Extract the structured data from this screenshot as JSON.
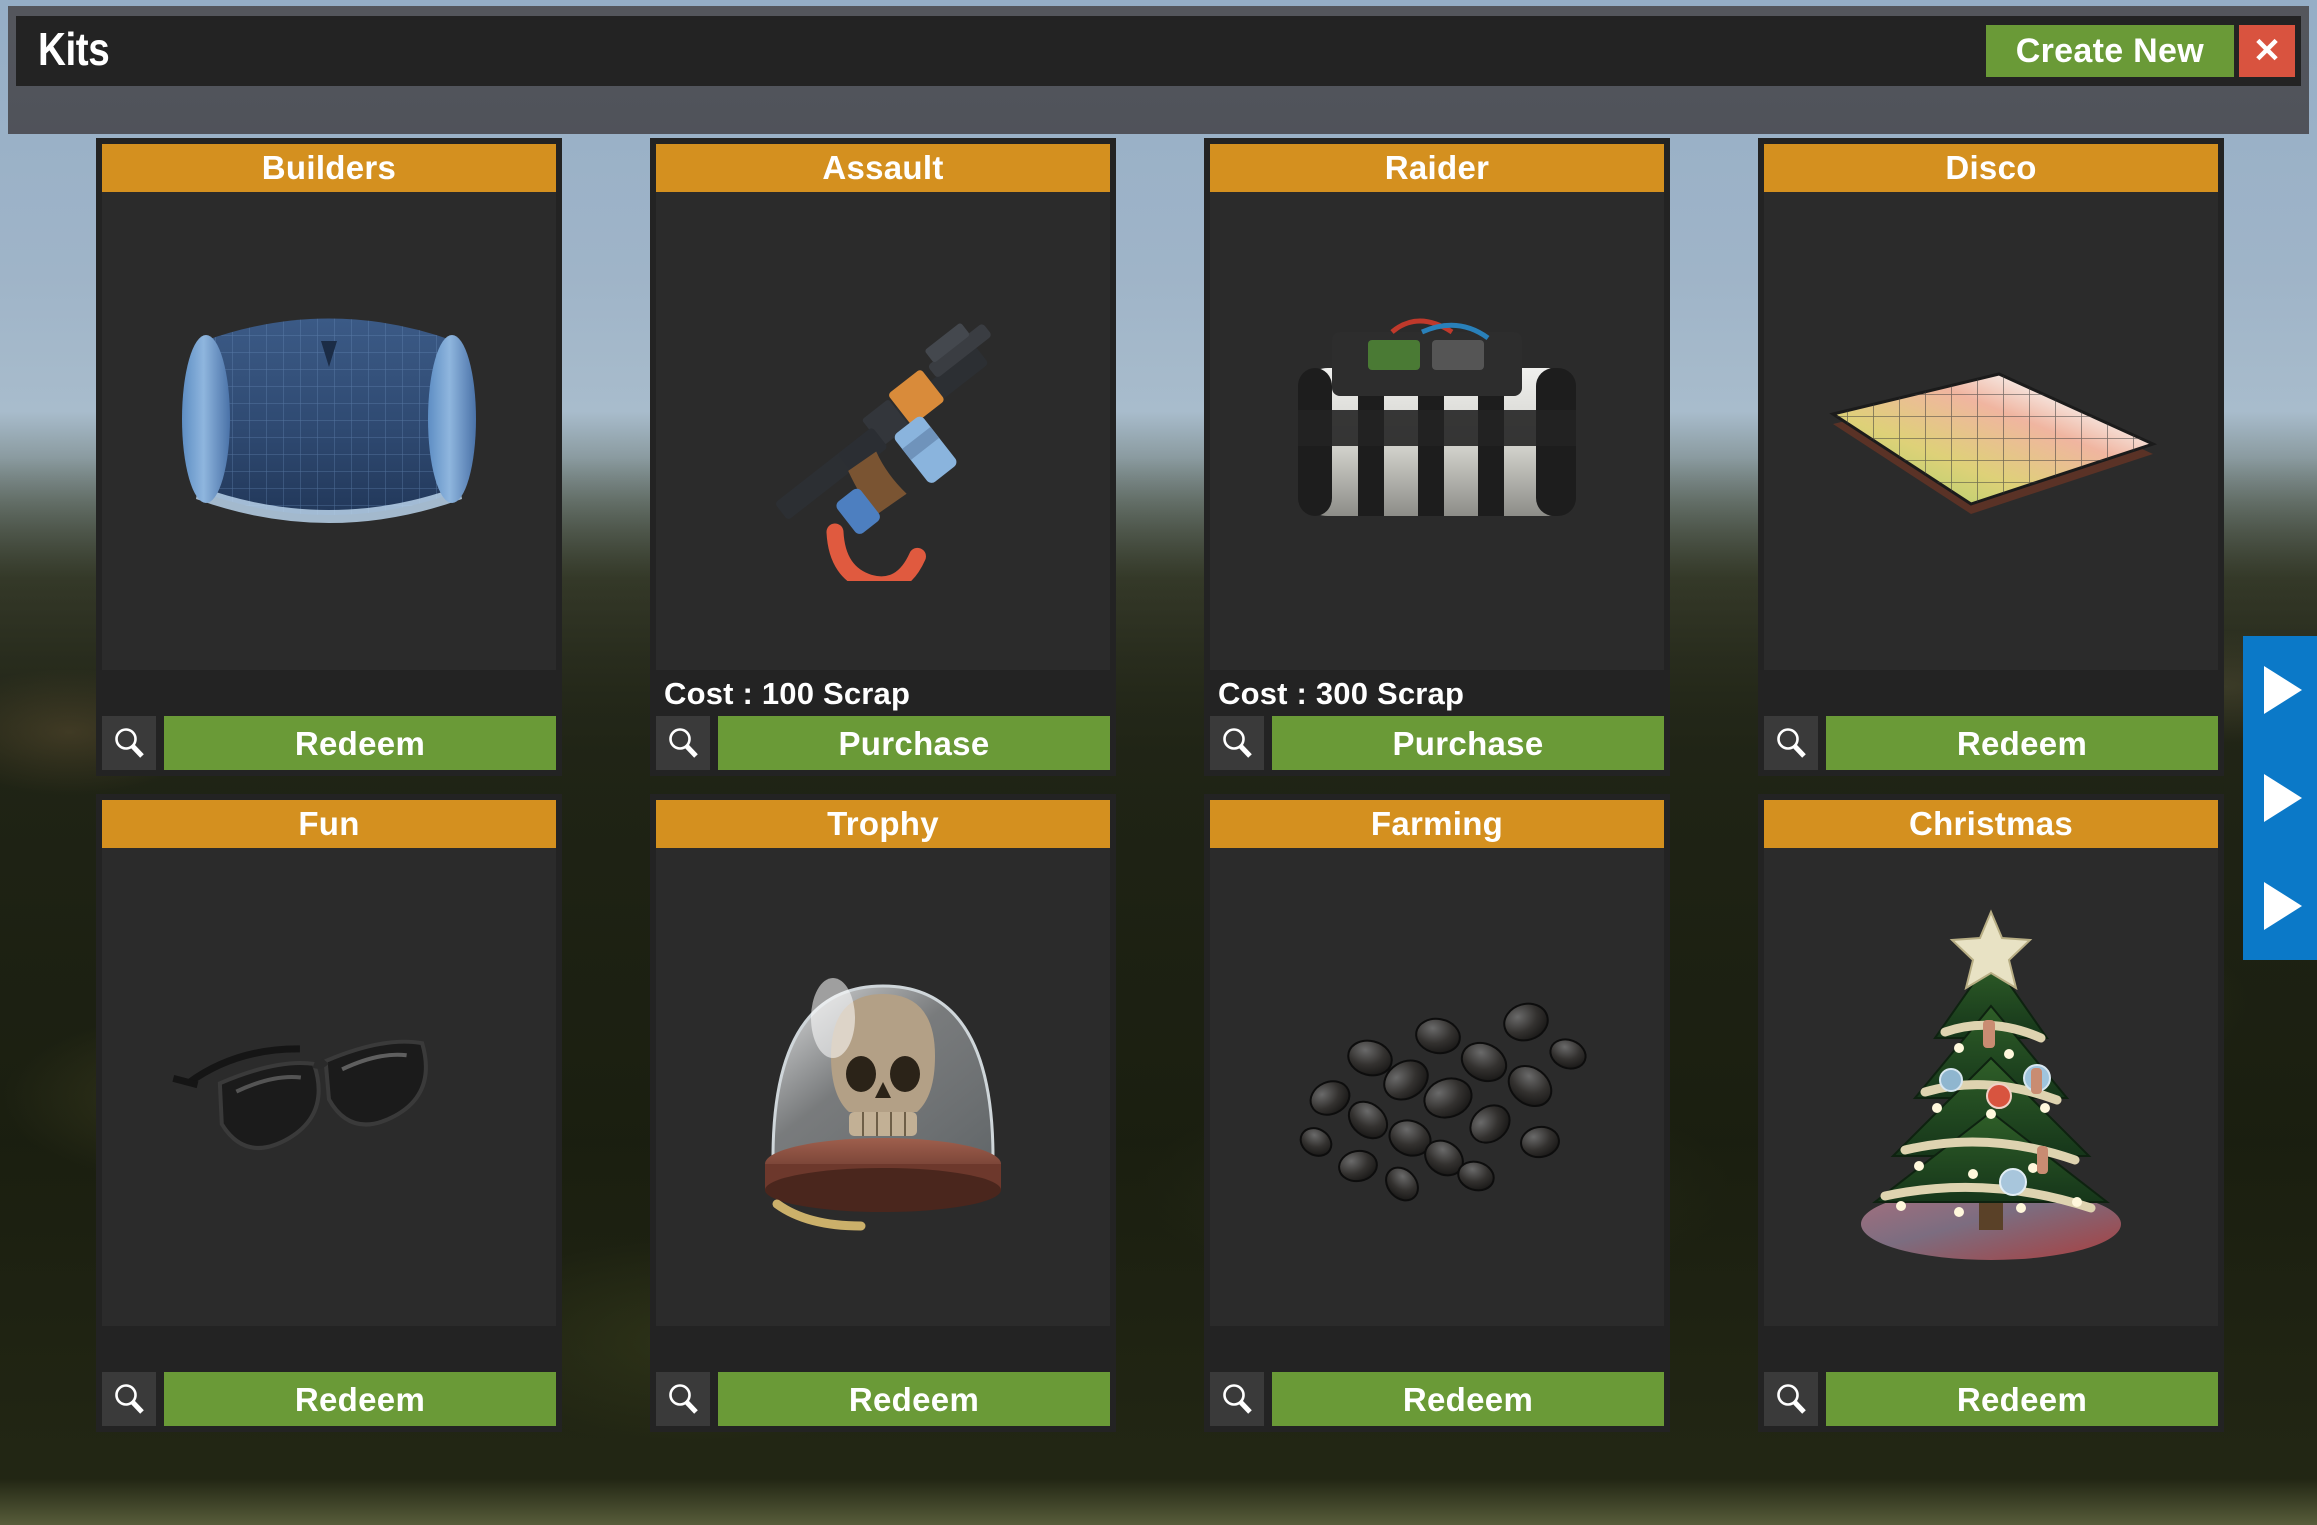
{
  "window": {
    "title": "Kits",
    "create_new_label": "Create New",
    "close_label": "✕"
  },
  "kits": [
    {
      "name": "Builders",
      "cost": "",
      "action_label": "Redeem",
      "art": "blueprint",
      "magnify_icon": "search-icon"
    },
    {
      "name": "Assault",
      "cost": "Cost : 100 Scrap",
      "action_label": "Purchase",
      "art": "rifle",
      "magnify_icon": "search-icon"
    },
    {
      "name": "Raider",
      "cost": "Cost : 300 Scrap",
      "action_label": "Purchase",
      "art": "explosive-charge",
      "magnify_icon": "search-icon"
    },
    {
      "name": "Disco",
      "cost": "",
      "action_label": "Redeem",
      "art": "disco-floor",
      "magnify_icon": "search-icon"
    },
    {
      "name": "Fun",
      "cost": "",
      "action_label": "Redeem",
      "art": "sunglasses",
      "magnify_icon": "search-icon"
    },
    {
      "name": "Trophy",
      "cost": "",
      "action_label": "Redeem",
      "art": "skull-trophy",
      "magnify_icon": "search-icon"
    },
    {
      "name": "Farming",
      "cost": "",
      "action_label": "Redeem",
      "art": "seeds",
      "magnify_icon": "search-icon"
    },
    {
      "name": "Christmas",
      "cost": "",
      "action_label": "Redeem",
      "art": "christmas-tree",
      "magnify_icon": "search-icon"
    }
  ],
  "side_arrows": {
    "count": 3,
    "icon": "play-arrow-icon"
  },
  "colors": {
    "header_orange": "#d4901f",
    "button_green": "#6a9a37",
    "close_red": "#d9533f",
    "panel_dark": "#232323",
    "card_body": "#2b2b2b",
    "arrow_blue": "#0b79c8"
  }
}
